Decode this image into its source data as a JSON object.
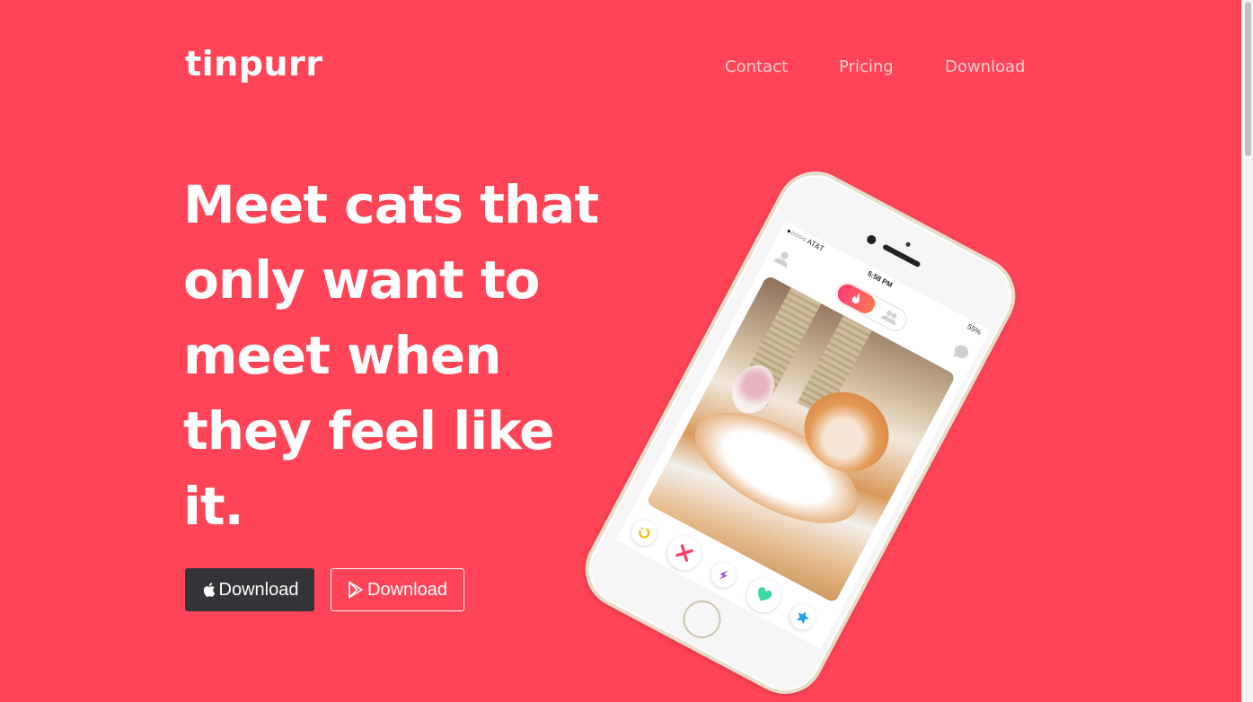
{
  "brand": {
    "name": "tinpurr"
  },
  "nav": {
    "items": [
      {
        "label": "Contact"
      },
      {
        "label": "Pricing"
      },
      {
        "label": "Download"
      }
    ]
  },
  "hero": {
    "headline": "Meet cats that only want to meet when they feel like it.",
    "buttons": {
      "apple_label": "Download",
      "play_label": "Download"
    }
  },
  "phone": {
    "status": {
      "carrier": "●○○○○ AT&T",
      "time": "5:58 PM",
      "battery": "55%"
    },
    "icons": {
      "profile": "profile-icon",
      "chat": "chat-icon",
      "flame": "flame-icon",
      "rewind": "rewind-icon",
      "nope": "nope-icon",
      "boost": "boost-icon",
      "like": "heart-icon",
      "superlike": "star-icon"
    }
  },
  "colors": {
    "background": "#ff4457",
    "apple_button": "#323437",
    "text": "#ffffff"
  }
}
